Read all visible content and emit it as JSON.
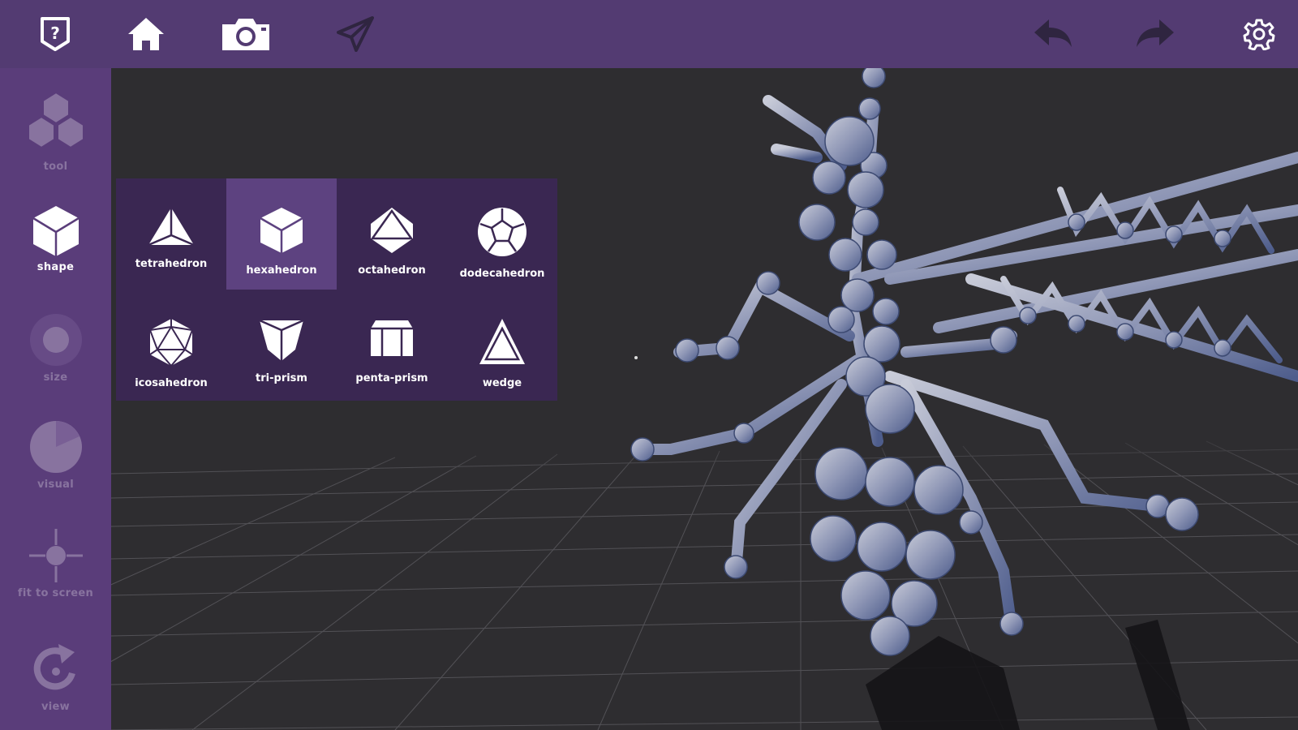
{
  "toolbar": {
    "help_icon": "help-icon",
    "home_icon": "home-icon",
    "camera_icon": "camera-icon",
    "share_icon": "send-icon",
    "undo_icon": "undo-icon",
    "redo_icon": "redo-icon",
    "settings_icon": "gear-icon"
  },
  "sidebar": {
    "items": [
      {
        "label": "tool",
        "icon": "tool-icon",
        "enabled": false
      },
      {
        "label": "shape",
        "icon": "cube-icon",
        "enabled": true
      },
      {
        "label": "size",
        "icon": "size-icon",
        "enabled": false
      },
      {
        "label": "visual",
        "icon": "visual-icon",
        "enabled": false
      },
      {
        "label": "fit to screen",
        "icon": "crosshair-icon",
        "enabled": false
      },
      {
        "label": "view",
        "icon": "rotate-icon",
        "enabled": false
      }
    ]
  },
  "shape_menu": {
    "selected": "hexahedron",
    "items": [
      {
        "label": "tetrahedron",
        "icon": "tetrahedron-icon"
      },
      {
        "label": "hexahedron",
        "icon": "hexahedron-icon"
      },
      {
        "label": "octahedron",
        "icon": "octahedron-icon"
      },
      {
        "label": "dodecahedron",
        "icon": "dodecahedron-icon"
      },
      {
        "label": "icosahedron",
        "icon": "icosahedron-icon"
      },
      {
        "label": "tri-prism",
        "icon": "tri-prism-icon"
      },
      {
        "label": "penta-prism",
        "icon": "penta-prism-icon"
      },
      {
        "label": "wedge",
        "icon": "wedge-icon"
      }
    ]
  },
  "colors": {
    "topbar": "#533b72",
    "sidebar": "#5a3d7a",
    "viewport": "#2e2d30",
    "menu": "#3a2752",
    "selected": "#5d4280"
  }
}
